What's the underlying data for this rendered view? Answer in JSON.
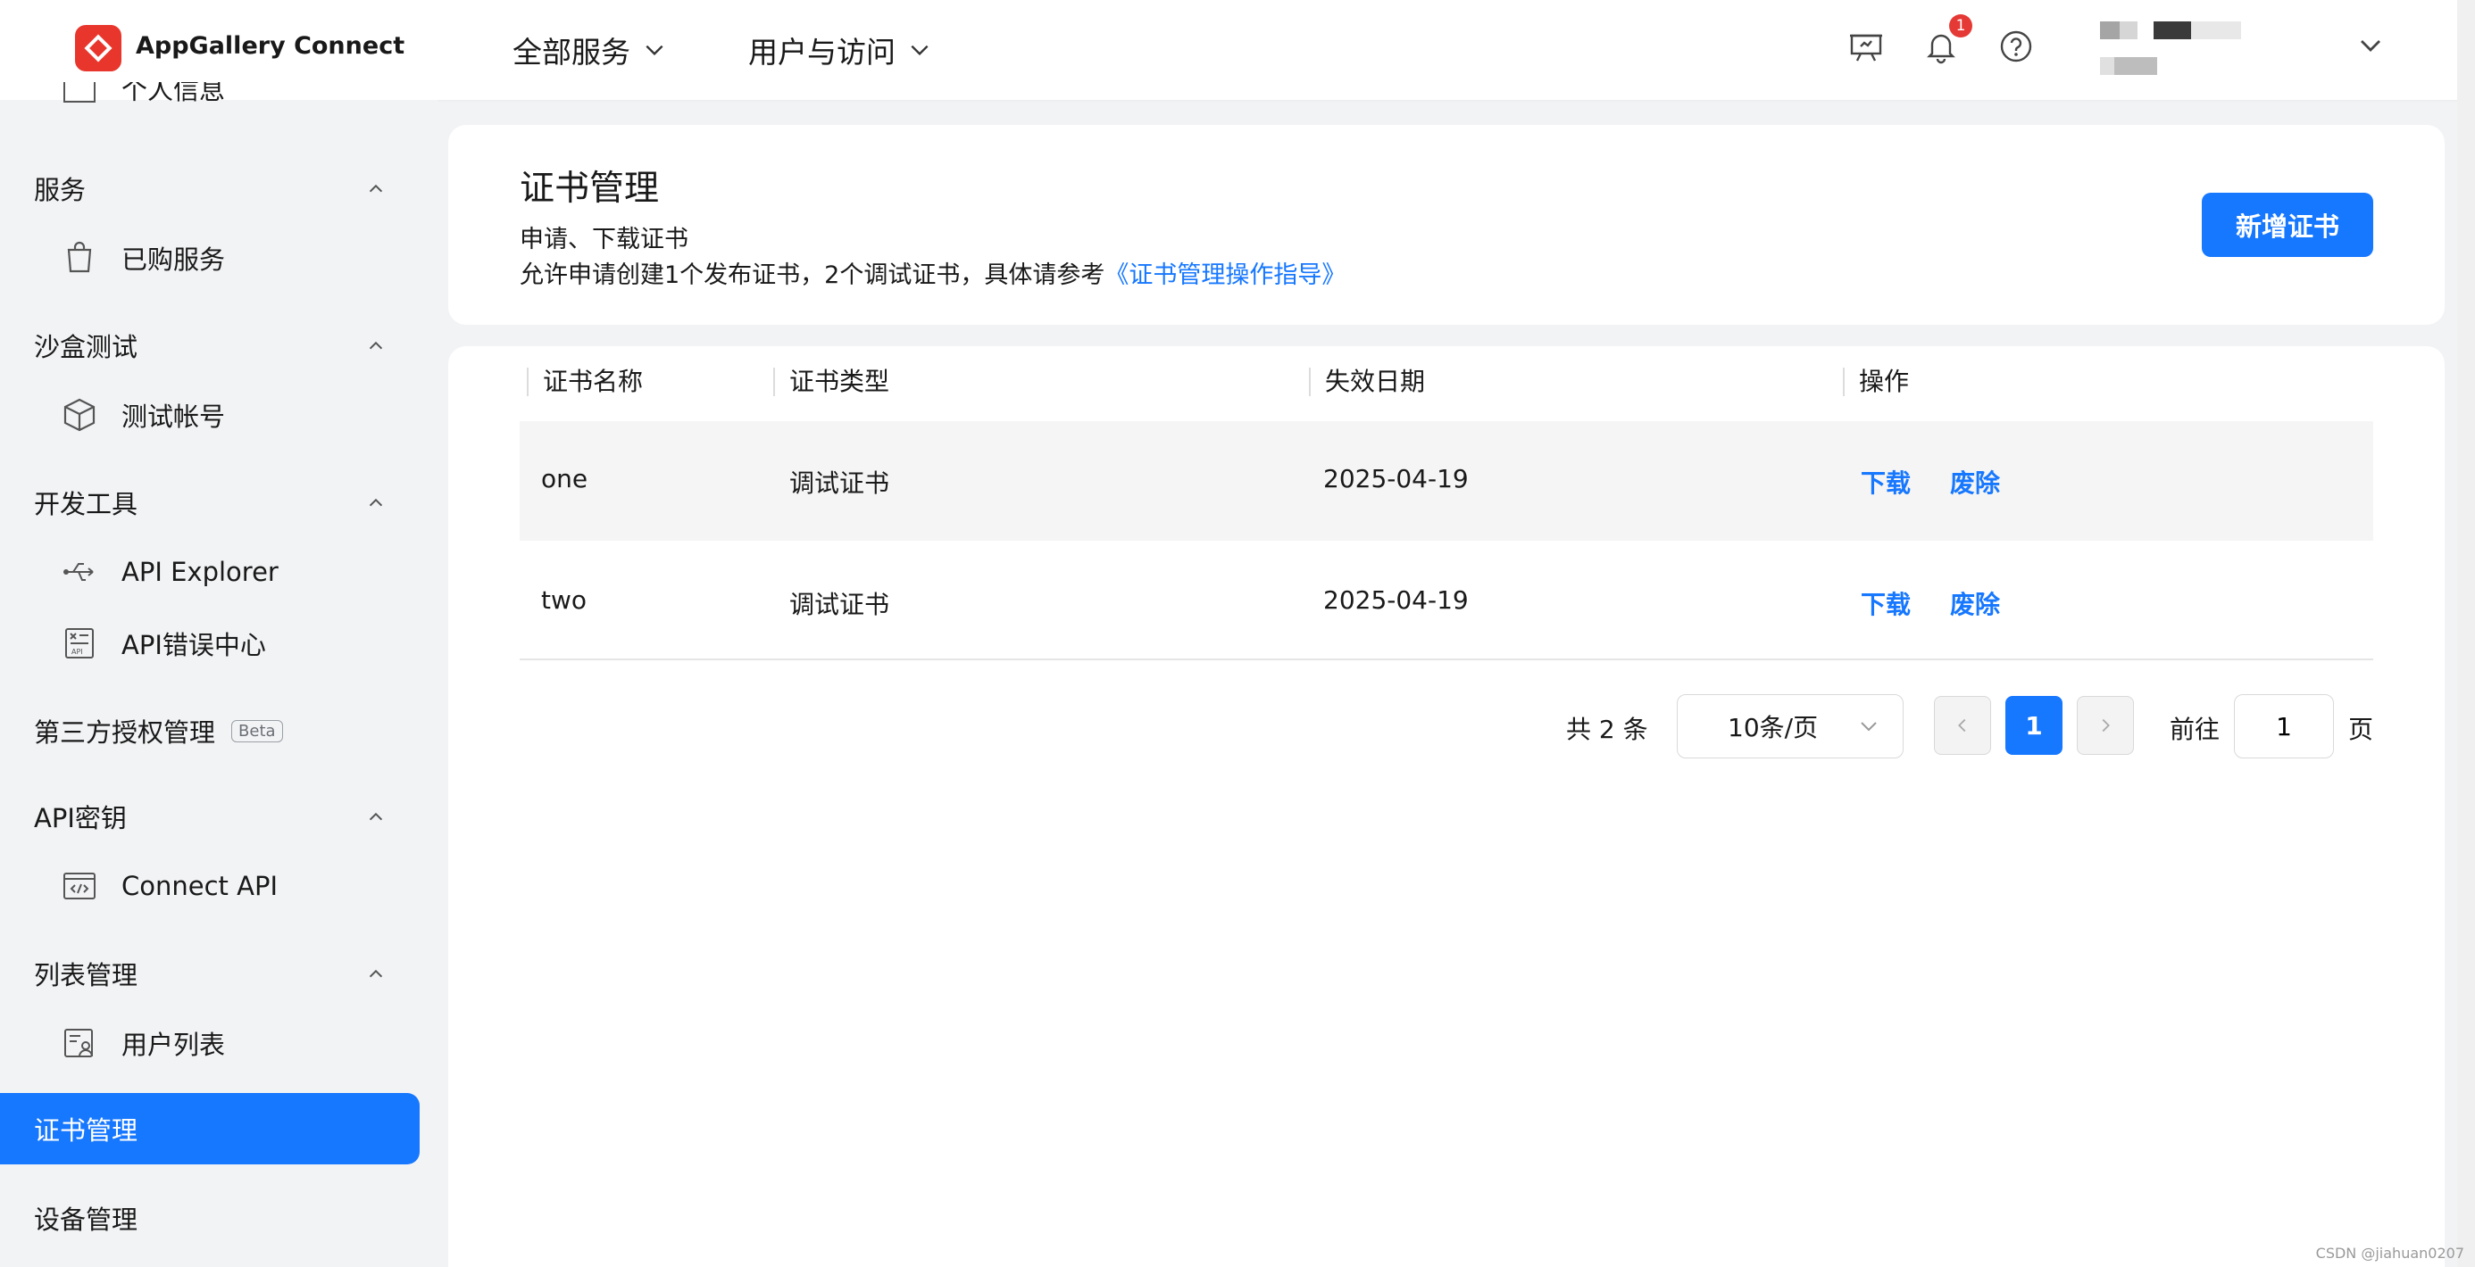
{
  "app": {
    "name": "AppGallery Connect",
    "notification_count": "1"
  },
  "topnav": {
    "menu1": "全部服务",
    "menu2": "用户与访问"
  },
  "sidebar": {
    "partial_top": "个人信息",
    "group_service": "服务",
    "item_purchased": "已购服务",
    "group_sandbox": "沙盒测试",
    "item_test_account": "测试帐号",
    "group_devtools": "开发工具",
    "item_api_explorer": "API Explorer",
    "item_api_error": "API错误中心",
    "item_third_party": "第三方授权管理",
    "beta": "Beta",
    "group_apikey": "API密钥",
    "item_connect_api": "Connect API",
    "group_list": "列表管理",
    "item_user_list": "用户列表",
    "item_cert": "证书管理",
    "item_device": "设备管理"
  },
  "header": {
    "title": "证书管理",
    "desc1": "申请、下载证书",
    "desc2_prefix": "允许申请创建1个发布证书，2个调试证书，具体请参考",
    "desc2_link": "《证书管理操作指导》",
    "add_button": "新增证书"
  },
  "table": {
    "columns": [
      "证书名称",
      "证书类型",
      "失效日期",
      "操作"
    ],
    "rows": [
      {
        "name": "one",
        "type": "调试证书",
        "expiry": "2025-04-19",
        "download": "下载",
        "revoke": "废除"
      },
      {
        "name": "two",
        "type": "调试证书",
        "expiry": "2025-04-19",
        "download": "下载",
        "revoke": "废除"
      }
    ]
  },
  "pagination": {
    "total_prefix": "共",
    "total": "2",
    "total_suffix": "条",
    "page_size": "10条/页",
    "current_page": "1",
    "goto_label": "前往",
    "goto_value": "1",
    "goto_suffix": "页"
  },
  "watermark": "CSDN @jiahuan0207",
  "colors": {
    "primary": "#1677ff",
    "logo": "#e8362d",
    "badge": "#e53935"
  }
}
